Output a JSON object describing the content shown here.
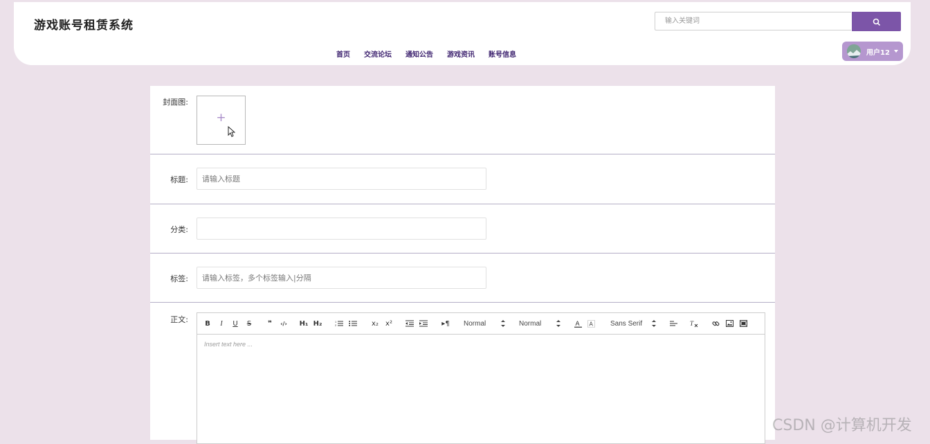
{
  "header": {
    "title": "游戏账号租赁系统",
    "search_placeholder": "输入关键词",
    "nav": [
      "首页",
      "交流论坛",
      "通知公告",
      "游戏资讯",
      "账号信息"
    ],
    "user": "用户12"
  },
  "form": {
    "cover_label": "封面图:",
    "cover_plus": "+",
    "title_label": "标题:",
    "title_placeholder": "请输入标题",
    "category_label": "分类:",
    "category_value": "",
    "tags_label": "标签:",
    "tags_placeholder": "请输入标签，多个标签输入|分隔",
    "content_label": "正文:"
  },
  "editor": {
    "bold": "B",
    "italic": "I",
    "underline": "U",
    "strike": "S",
    "quote": "❞",
    "code": "‹/›",
    "h1": "H₁",
    "h2": "H₂",
    "subscript": "x₂",
    "superscript": "x²",
    "direction": "▸¶",
    "size_select": "Normal",
    "header_select": "Normal",
    "font_select": "Sans Serif",
    "placeholder": "Insert text here ..."
  },
  "colors": {
    "accent": "#7c55a8",
    "nav_text": "#3f2470",
    "user_chip": "#b597cf",
    "background": "#ece1ea"
  },
  "watermark": "CSDN @计算机开发"
}
